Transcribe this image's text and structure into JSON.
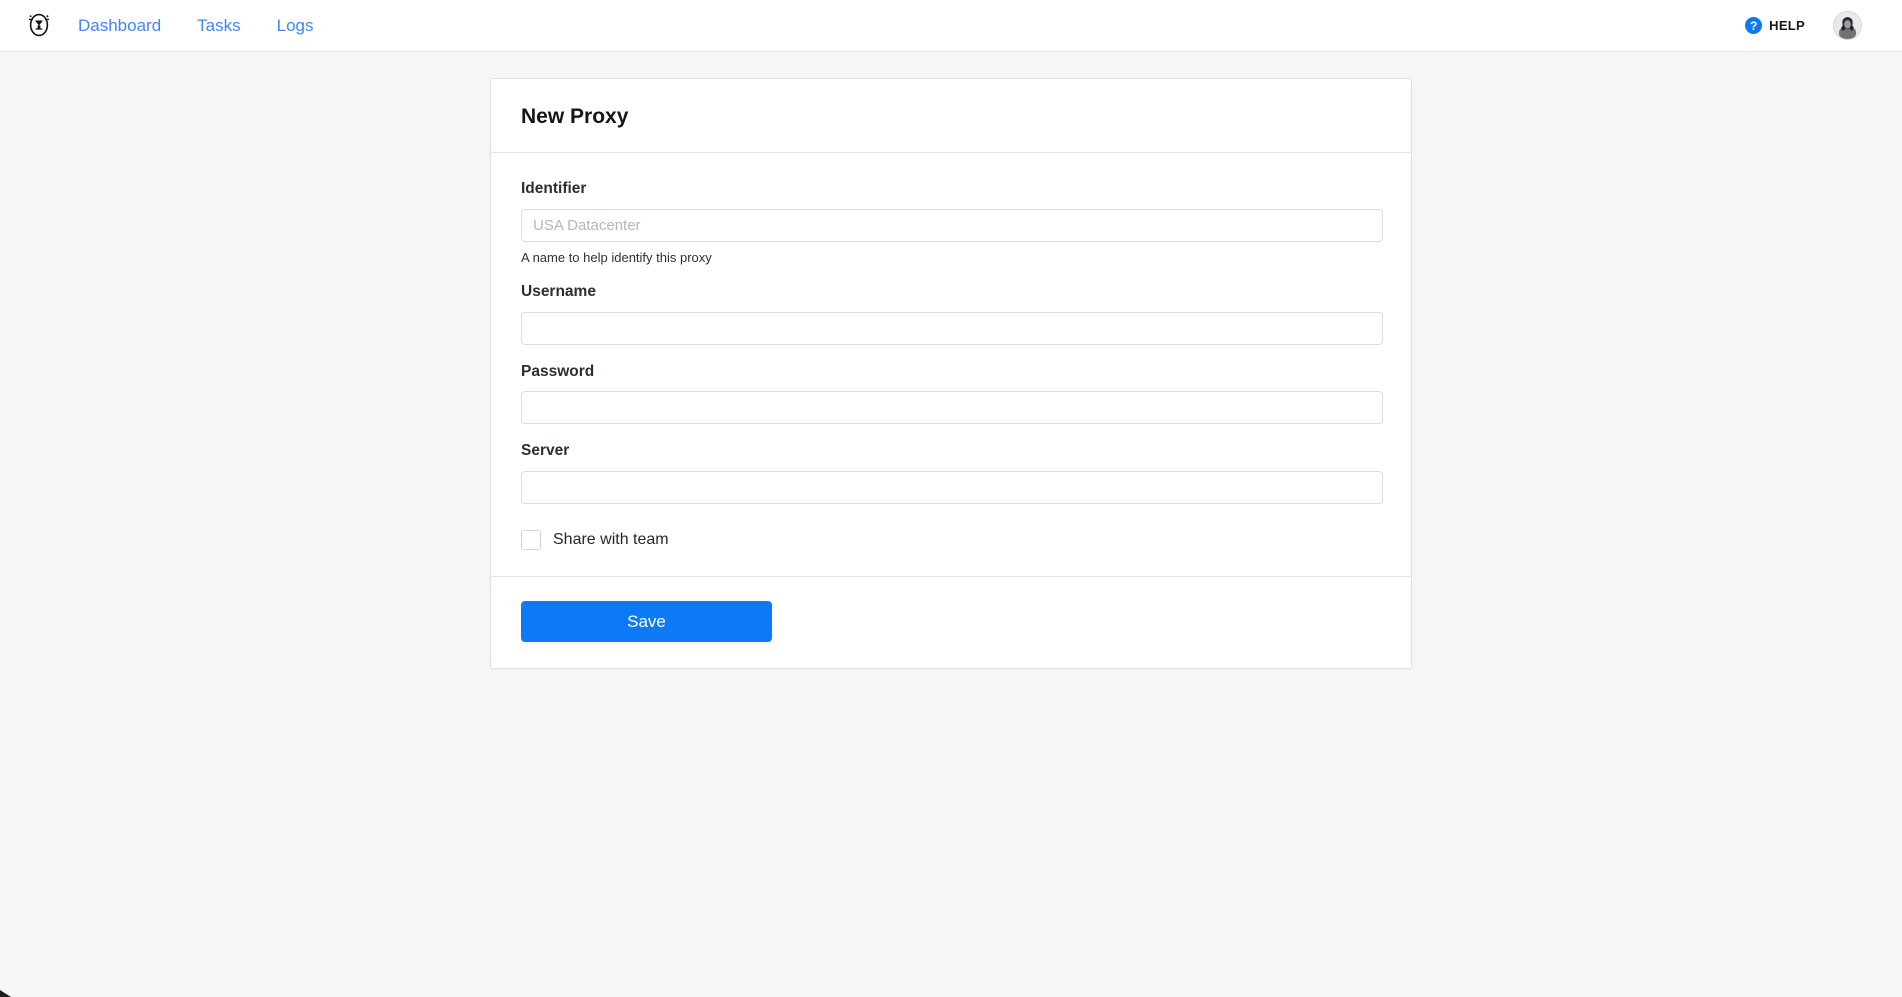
{
  "navbar": {
    "brand_icon": "egg-mascot-logo",
    "links": [
      {
        "label": "Dashboard"
      },
      {
        "label": "Tasks"
      },
      {
        "label": "Logs"
      }
    ],
    "help": {
      "icon": "question-mark-circle-icon",
      "icon_glyph": "?",
      "label": "HELP",
      "color": "#0f77ef"
    },
    "avatar": {
      "icon": "user-avatar",
      "alt": "User avatar"
    }
  },
  "card": {
    "title": "New Proxy",
    "fields": [
      {
        "label": "Identifier",
        "value": "",
        "placeholder": "USA Datacenter",
        "help": "A name to help identify this proxy",
        "type": "text",
        "name": "identifier"
      },
      {
        "label": "Username",
        "value": "",
        "placeholder": "",
        "help": "",
        "type": "text",
        "name": "username"
      },
      {
        "label": "Password",
        "value": "",
        "placeholder": "",
        "help": "",
        "type": "text",
        "name": "password"
      },
      {
        "label": "Server",
        "value": "",
        "placeholder": "",
        "help": "",
        "type": "text",
        "name": "server"
      }
    ],
    "share_checkbox": {
      "label": "Share with team",
      "checked": false
    },
    "footer": {
      "save_label": "Save",
      "save_color": "#0d7af5"
    }
  }
}
